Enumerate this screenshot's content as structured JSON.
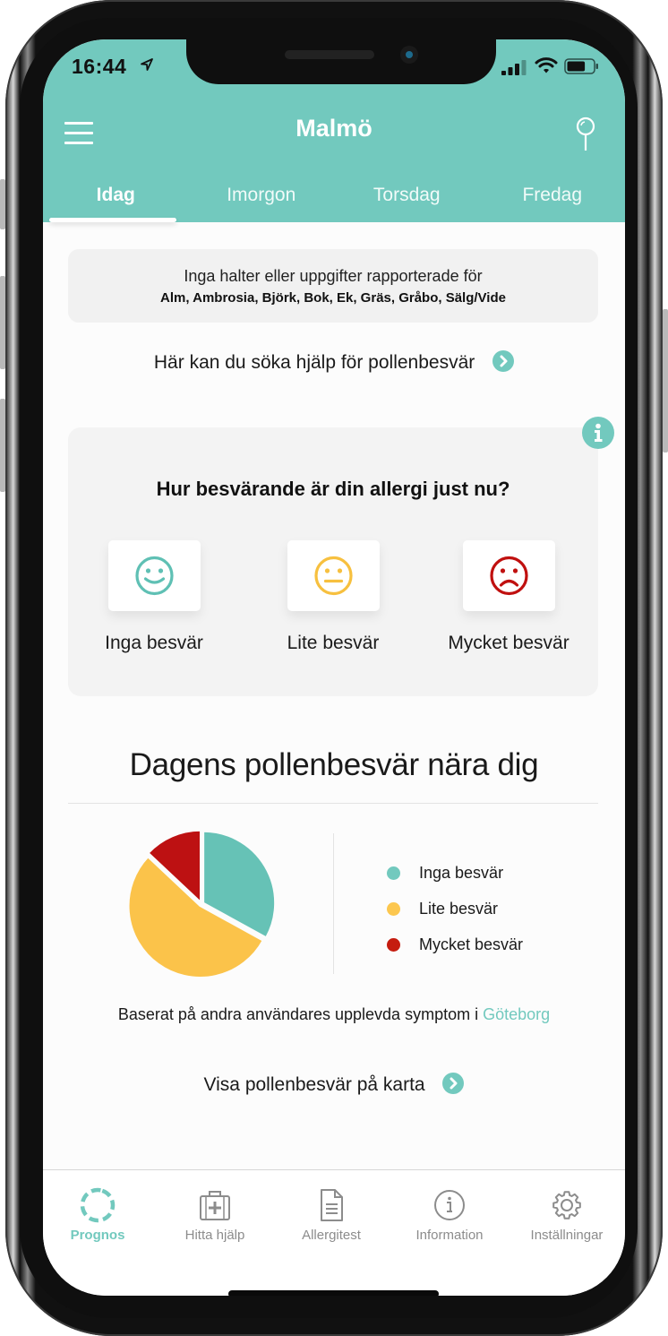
{
  "status_bar": {
    "time": "16:44",
    "signal_bars": 3,
    "signal_bars_max": 4,
    "battery_level": 0.7
  },
  "header": {
    "title": "Malmö",
    "menu_icon": "hamburger-menu-icon",
    "location_icon": "map-pin-icon"
  },
  "tabs": [
    {
      "label": "Idag",
      "active": true
    },
    {
      "label": "Imorgon",
      "active": false
    },
    {
      "label": "Torsdag",
      "active": false
    },
    {
      "label": "Fredag",
      "active": false
    }
  ],
  "notice": {
    "line1": "Inga halter eller uppgifter rapporterade för",
    "line2": "Alm, Ambrosia, Björk, Bok, Ek, Gräs, Gråbo, Sälg/Vide"
  },
  "help_link": {
    "label": "Här kan du söka hjälp för pollenbesvär",
    "icon": "chevron-right-circle-icon"
  },
  "survey": {
    "question": "Hur besvärande är din allergi just nu?",
    "info_icon": "info-icon",
    "options": [
      {
        "label": "Inga besvär",
        "icon": "smiley-happy-icon",
        "color": "#5fc0b4"
      },
      {
        "label": "Lite besvär",
        "icon": "smiley-neutral-icon",
        "color": "#f7c03f"
      },
      {
        "label": "Mycket besvär",
        "icon": "smiley-sad-icon",
        "color": "#c0100f"
      }
    ]
  },
  "nearby": {
    "title": "Dagens pollenbesvär nära dig",
    "based_on_prefix": "Baserat på andra användares upplevda symptom i ",
    "based_on_city": "Göteborg",
    "map_link": "Visa pollenbesvär på karta"
  },
  "chart_data": {
    "type": "pie",
    "title": "Dagens pollenbesvär nära dig",
    "categories": [
      "Inga besvär",
      "Lite besvär",
      "Mycket besvär"
    ],
    "values": [
      33,
      54,
      13
    ],
    "unit": "percent (estimated)",
    "colors": [
      "#66c2b6",
      "#fbc34a",
      "#bd1112"
    ],
    "start_angle": "12 o'clock, clockwise",
    "legend": "right"
  },
  "bottom_nav": [
    {
      "label": "Prognos",
      "icon": "dashed-circle-icon",
      "active": true
    },
    {
      "label": "Hitta hjälp",
      "icon": "first-aid-kit-icon",
      "active": false
    },
    {
      "label": "Allergitest",
      "icon": "document-icon",
      "active": false
    },
    {
      "label": "Information",
      "icon": "info-circle-icon",
      "active": false
    },
    {
      "label": "Inställningar",
      "icon": "gear-icon",
      "active": false
    }
  ],
  "colors": {
    "accent": "#72c9be",
    "inactive_nav": "#8c8c8c",
    "card_bg": "#f3f3f3"
  }
}
